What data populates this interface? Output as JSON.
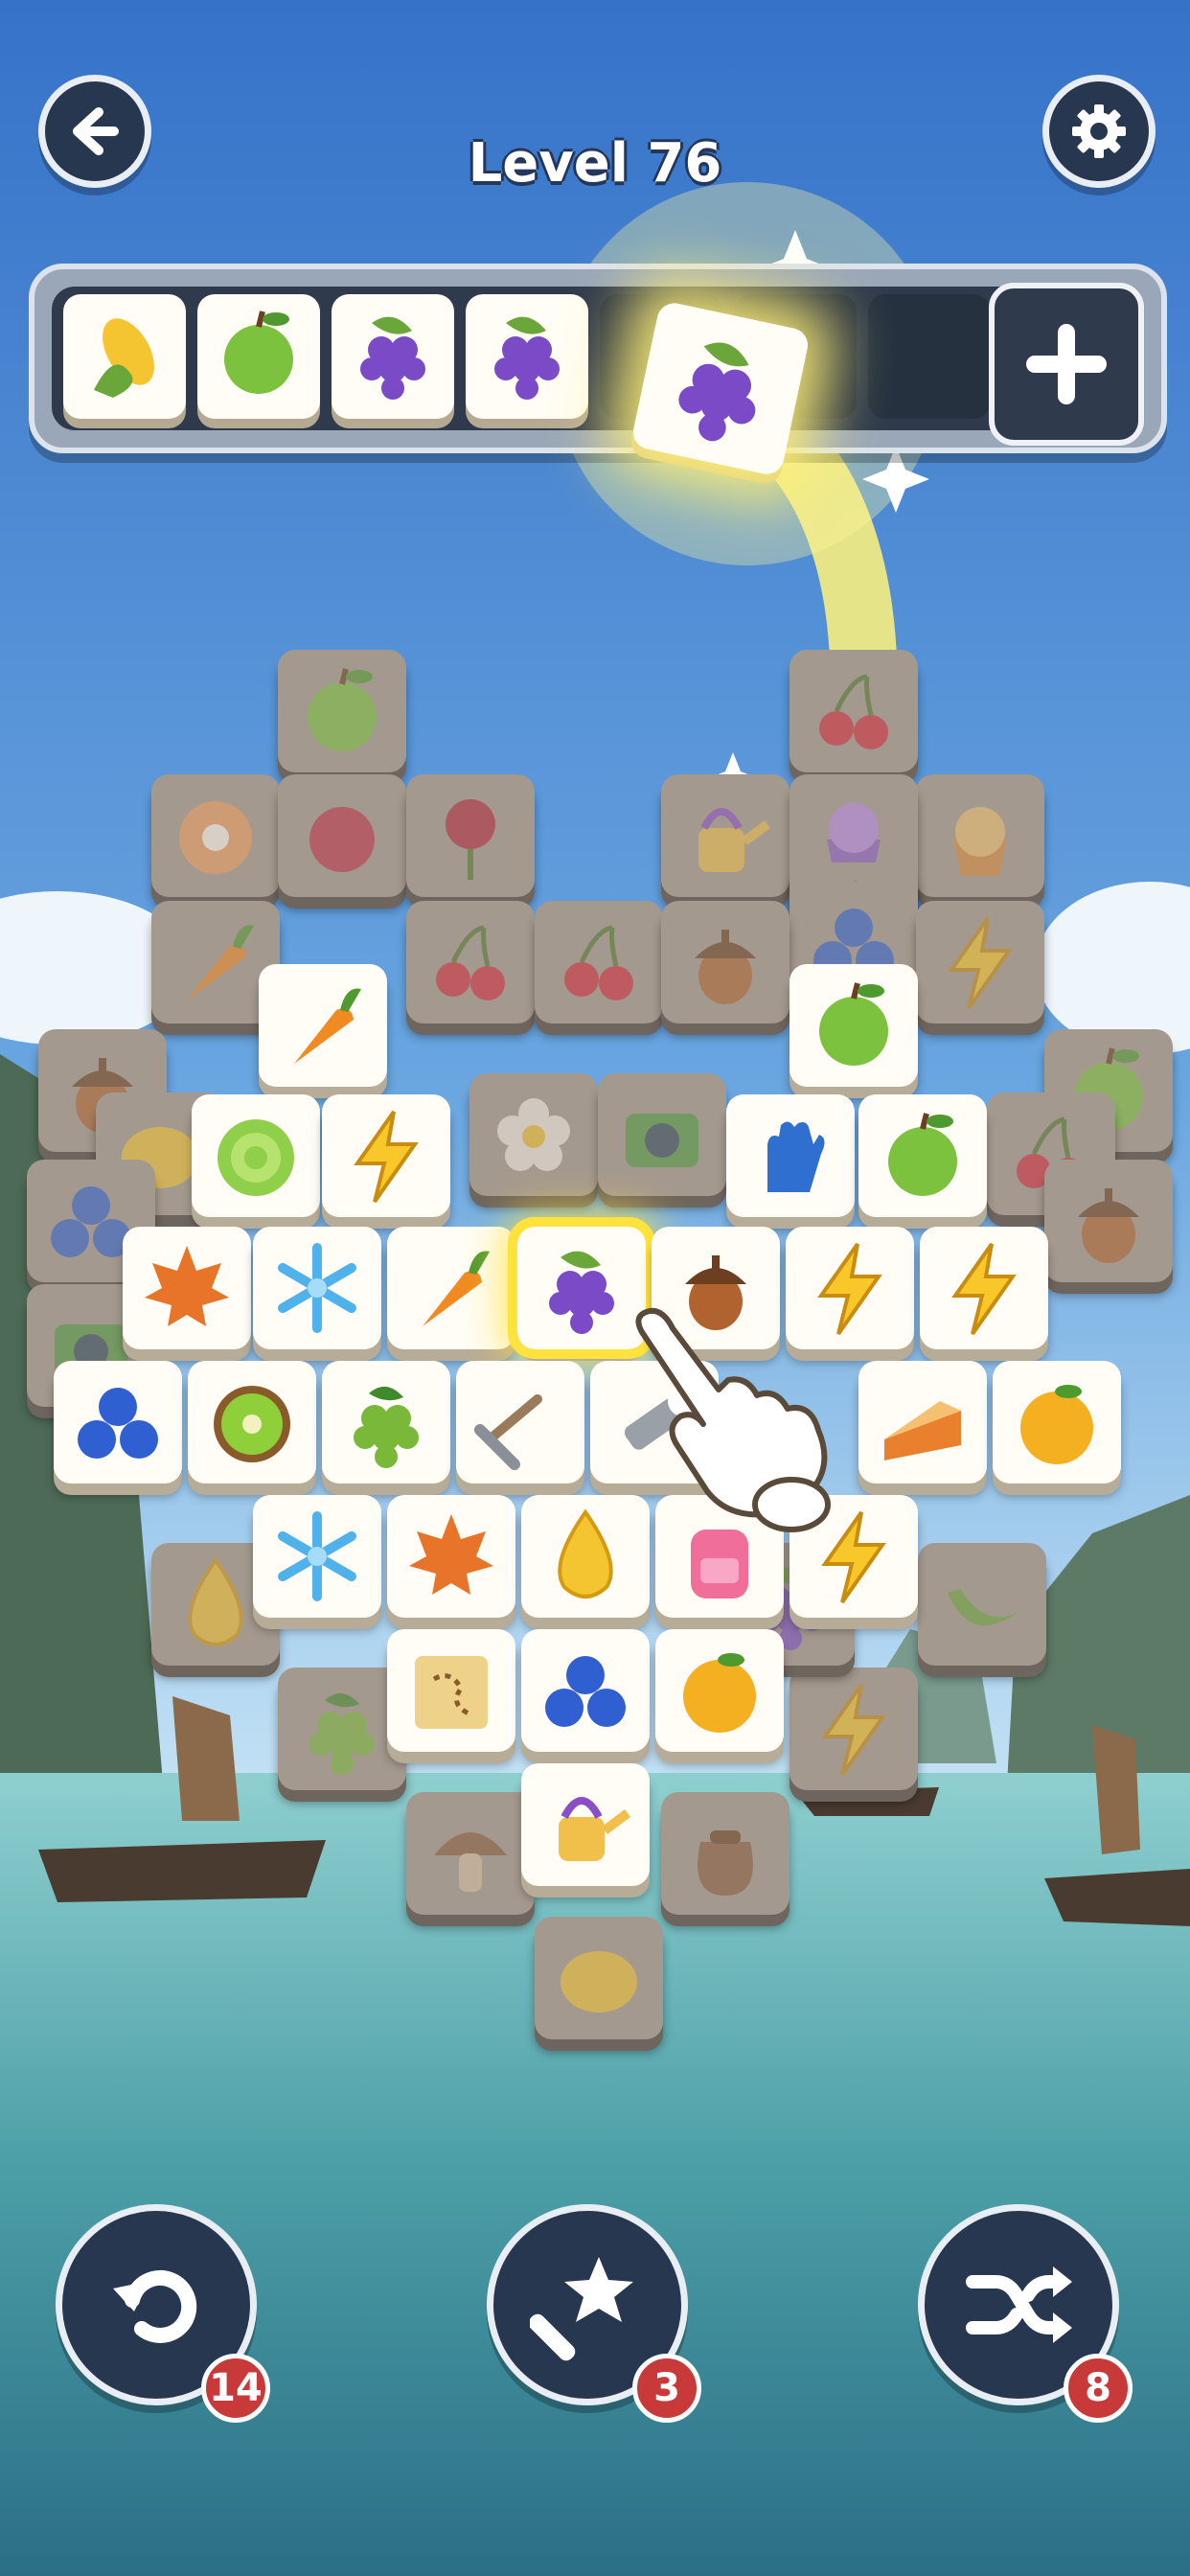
{
  "level": {
    "title": "Level 76"
  },
  "header": {
    "back_icon": "arrow-left-icon",
    "settings_icon": "gear-icon"
  },
  "tray": {
    "add_icon": "plus-icon",
    "slots": [
      {
        "item": "corn"
      },
      {
        "item": "apple"
      },
      {
        "item": "grapes"
      },
      {
        "item": "grapes"
      },
      {
        "item": ""
      },
      {
        "item": ""
      },
      {
        "item": ""
      }
    ],
    "flying_tile": "grapes"
  },
  "boosters": [
    {
      "name": "undo",
      "icon": "undo-icon",
      "count": "14"
    },
    {
      "name": "magic-wand",
      "icon": "magic-wand-icon",
      "count": "3"
    },
    {
      "name": "shuffle",
      "icon": "shuffle-icon",
      "count": "8"
    }
  ],
  "colors": {
    "sky_top": "#3a7bd0",
    "sky_bottom": "#b9dcf3",
    "water": "#4fa3a8",
    "button_dark": "#26374f",
    "badge_red": "#c83a3a",
    "tile_face": "#fffdf6",
    "highlight_yellow": "#ffe23c"
  },
  "board": {
    "front_tiles": [
      {
        "item": "carrot"
      },
      {
        "item": "apple"
      },
      {
        "item": "lettuce"
      },
      {
        "item": "lightning"
      },
      {
        "item": "glove"
      },
      {
        "item": "apple"
      },
      {
        "item": "maple-leaf"
      },
      {
        "item": "snowflake"
      },
      {
        "item": "carrot"
      },
      {
        "item": "grapes",
        "selected": true
      },
      {
        "item": "acorn"
      },
      {
        "item": "lightning"
      },
      {
        "item": "lightning"
      },
      {
        "item": "blueberries"
      },
      {
        "item": "kiwi"
      },
      {
        "item": "green-grapes"
      },
      {
        "item": "rake"
      },
      {
        "item": "flashlight"
      },
      {
        "item": "pie"
      },
      {
        "item": "orange"
      },
      {
        "item": "snowflake"
      },
      {
        "item": "maple-leaf"
      },
      {
        "item": "drop"
      },
      {
        "item": "backpack"
      },
      {
        "item": "lightning"
      },
      {
        "item": "map"
      },
      {
        "item": "blueberries"
      },
      {
        "item": "orange"
      },
      {
        "item": "watering-can"
      }
    ],
    "back_tiles": [
      {
        "item": "apple"
      },
      {
        "item": "cherries"
      },
      {
        "item": "donut"
      },
      {
        "item": "berry"
      },
      {
        "item": "rose"
      },
      {
        "item": "watering-can"
      },
      {
        "item": "muffin"
      },
      {
        "item": "cupcake"
      },
      {
        "item": "apple"
      },
      {
        "item": "blueberries"
      },
      {
        "item": "carrot"
      },
      {
        "item": "cherries"
      },
      {
        "item": "cherries"
      },
      {
        "item": "acorn"
      },
      {
        "item": "lightning"
      },
      {
        "item": "acorn"
      },
      {
        "item": "lemon"
      },
      {
        "item": "flower"
      },
      {
        "item": "camera"
      },
      {
        "item": "apple"
      },
      {
        "item": "cherries"
      },
      {
        "item": "blueberries"
      },
      {
        "item": "camera"
      },
      {
        "item": "acorn"
      },
      {
        "item": "drop"
      },
      {
        "item": "green-grapes"
      },
      {
        "item": "mushroom"
      },
      {
        "item": "sack"
      },
      {
        "item": "lemon"
      },
      {
        "item": "banana"
      },
      {
        "item": "lightning"
      },
      {
        "item": "grapes"
      }
    ]
  }
}
